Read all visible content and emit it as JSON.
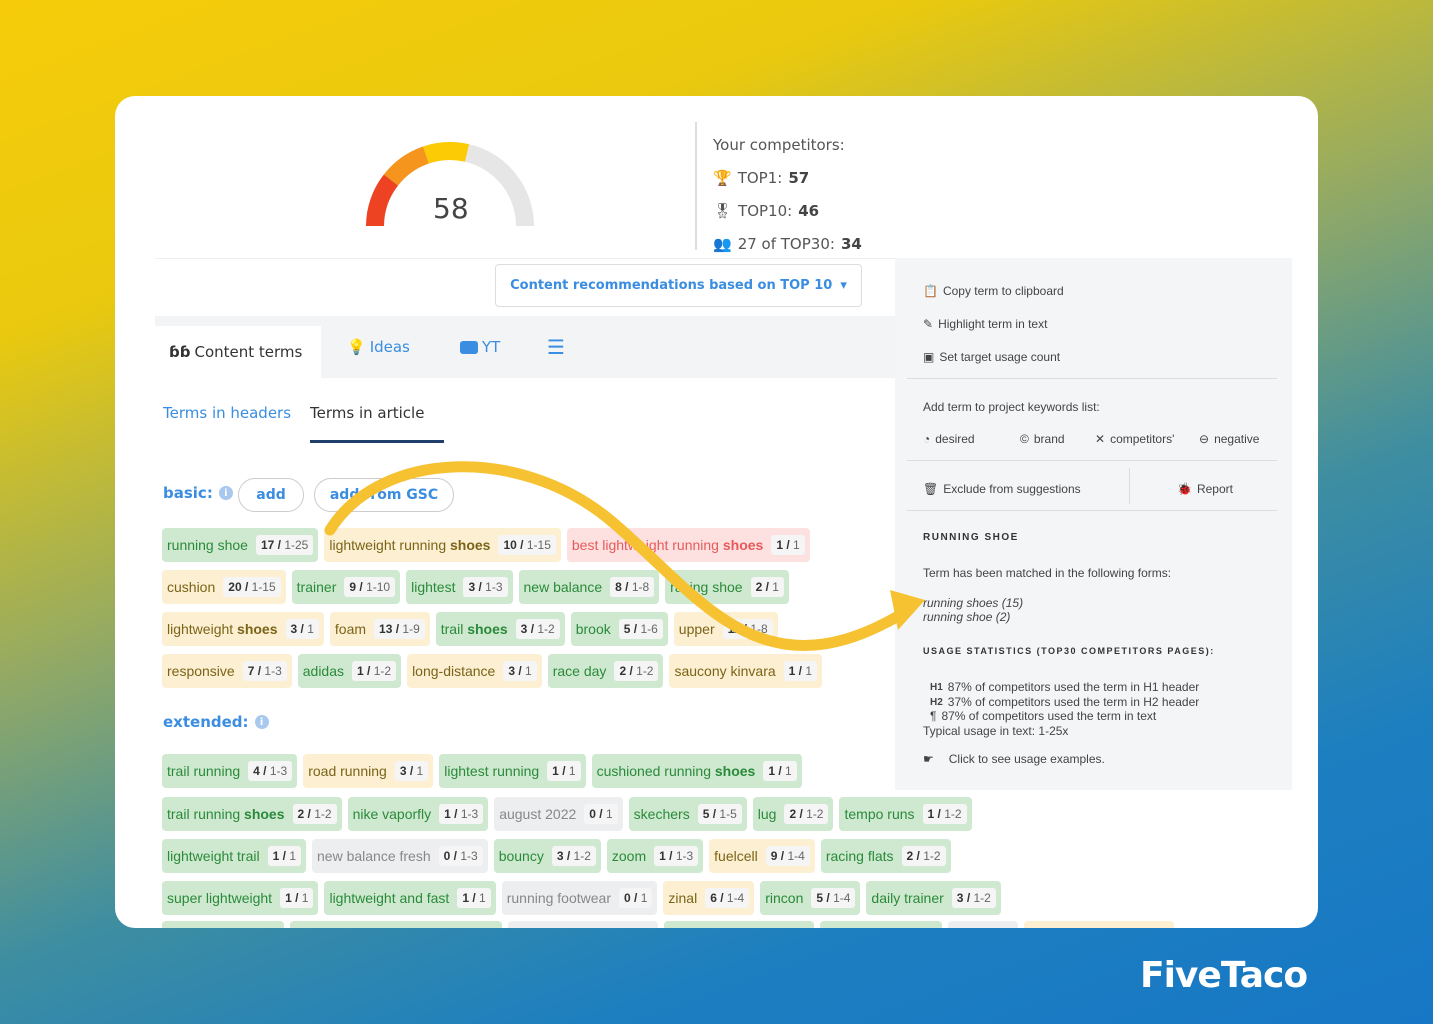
{
  "score": {
    "value": "58",
    "gauge_percent": 58,
    "colors": [
      "#ee4322",
      "#f5951e",
      "#fccb05",
      "#e6e6e6"
    ]
  },
  "competitors": {
    "title": "Your competitors:",
    "items": [
      {
        "icon": "trophy-icon",
        "label": "TOP1: ",
        "value": "57"
      },
      {
        "icon": "medal-icon",
        "label": "TOP10: ",
        "value": "46"
      },
      {
        "icon": "group-icon",
        "label": "27 of TOP30: ",
        "value": "34"
      }
    ]
  },
  "recommendations": {
    "label": "Content recommendations based on TOP 10"
  },
  "tabs": [
    {
      "label": "Content terms",
      "icon": "quote-icon"
    },
    {
      "label": "Ideas",
      "icon": "lightbulb-icon"
    },
    {
      "label": "YT",
      "icon": "youtube-icon"
    },
    {
      "label": "",
      "icon": "sliders-icon"
    }
  ],
  "subtabs": [
    "Terms in headers",
    "Terms in article"
  ],
  "basic": {
    "label": "basic:",
    "add": "add",
    "add_gsc": "add from GSC",
    "rows": [
      [
        {
          "t": "running shoe",
          "c": "17",
          "r": "1-25",
          "k": "g"
        },
        {
          "t": "lightweight running ",
          "b": "shoes",
          "c": "10",
          "r": "1-15",
          "k": "y"
        },
        {
          "t": "best lightweight running ",
          "b": "shoes",
          "c": "1",
          "r": "1",
          "k": "r"
        }
      ],
      [
        {
          "t": "cushion",
          "c": "20",
          "r": "1-15",
          "k": "y"
        },
        {
          "t": "trainer",
          "c": "9",
          "r": "1-10",
          "k": "g"
        },
        {
          "t": "lightest",
          "c": "3",
          "r": "1-3",
          "k": "g"
        },
        {
          "t": "new balance",
          "c": "8",
          "r": "1-8",
          "k": "g"
        },
        {
          "t": "racing shoe",
          "c": "2",
          "r": "1",
          "k": "g"
        }
      ],
      [
        {
          "t": "lightweight ",
          "b": "shoes",
          "c": "3",
          "r": "1",
          "k": "y"
        },
        {
          "t": "foam",
          "c": "13",
          "r": "1-9",
          "k": "y"
        },
        {
          "t": "trail ",
          "b": "shoes",
          "c": "3",
          "r": "1-2",
          "k": "g"
        },
        {
          "t": "brook",
          "c": "5",
          "r": "1-6",
          "k": "g"
        },
        {
          "t": "upper",
          "c": "11",
          "r": "1-8",
          "k": "y"
        }
      ],
      [
        {
          "t": "responsive",
          "c": "7",
          "r": "1-3",
          "k": "y"
        },
        {
          "t": "adidas",
          "c": "1",
          "r": "1-2",
          "k": "g"
        },
        {
          "t": "long-distance",
          "c": "3",
          "r": "1",
          "k": "y"
        },
        {
          "t": "race day",
          "c": "2",
          "r": "1-2",
          "k": "g"
        },
        {
          "t": "saucony kinvara",
          "c": "1",
          "r": "1",
          "k": "y"
        }
      ]
    ]
  },
  "extended": {
    "label": "extended:",
    "rows": [
      [
        {
          "t": "trail running",
          "c": "4",
          "r": "1-3",
          "k": "g"
        },
        {
          "t": "road running",
          "c": "3",
          "r": "1",
          "k": "y"
        },
        {
          "t": "lightest running",
          "c": "1",
          "r": "1",
          "k": "g"
        },
        {
          "t": "cushioned running ",
          "b": "shoes",
          "c": "1",
          "r": "1",
          "k": "g"
        }
      ],
      [
        {
          "t": "trail running ",
          "b": "shoes",
          "c": "2",
          "r": "1-2",
          "k": "g"
        },
        {
          "t": "nike vaporfly",
          "c": "1",
          "r": "1-3",
          "k": "g"
        },
        {
          "t": "august 2022",
          "c": "0",
          "r": "1",
          "k": "n"
        },
        {
          "t": "skechers",
          "c": "5",
          "r": "1-5",
          "k": "g"
        },
        {
          "t": "lug",
          "c": "2",
          "r": "1-2",
          "k": "g"
        },
        {
          "t": "tempo runs",
          "c": "1",
          "r": "1-2",
          "k": "g"
        }
      ],
      [
        {
          "t": "lightweight trail",
          "c": "1",
          "r": "1",
          "k": "g"
        },
        {
          "t": "new balance fresh",
          "c": "0",
          "r": "1-3",
          "k": "n"
        },
        {
          "t": "bouncy",
          "c": "3",
          "r": "1-2",
          "k": "g"
        },
        {
          "t": "zoom",
          "c": "1",
          "r": "1-3",
          "k": "g"
        },
        {
          "t": "fuelcell",
          "c": "9",
          "r": "1-4",
          "k": "y"
        },
        {
          "t": "racing flats",
          "c": "2",
          "r": "1-2",
          "k": "g"
        }
      ],
      [
        {
          "t": "super lightweight",
          "c": "1",
          "r": "1",
          "k": "g"
        },
        {
          "t": "lightweight and fast",
          "c": "1",
          "r": "1",
          "k": "g"
        },
        {
          "t": "running footwear",
          "c": "0",
          "r": "1",
          "k": "n"
        },
        {
          "t": "zinal",
          "c": "6",
          "r": "1-4",
          "k": "y"
        },
        {
          "t": "rincon",
          "c": "5",
          "r": "1-4",
          "k": "g"
        },
        {
          "t": "daily trainer",
          "c": "3",
          "r": "1-2",
          "k": "g"
        }
      ]
    ]
  },
  "panel": {
    "copy": "Copy term to clipboard",
    "highlight": "Highlight term in text",
    "target": "Set target usage count",
    "add_title": "Add term to project keywords list:",
    "desired": "desired",
    "brand": "brand",
    "competitors": "competitors'",
    "negative": "negative",
    "exclude": "Exclude from suggestions",
    "report": "Report",
    "term": "RUNNING SHOE",
    "matched": "Term has been matched in the following forms:",
    "form1": "running shoes (15)",
    "form2": "running shoe (2)",
    "usage_title": "USAGE STATISTICS (TOP30 COMPETITORS PAGES):",
    "h1": "H1",
    "h1_text": "87% of competitors used the term in H1 header",
    "h2": "H2",
    "h2_text": "37% of competitors used the term in H2 header",
    "text_stat": "87% of competitors used the term in text",
    "typical": "Typical usage in text: 1-25x",
    "examples": "Click to see usage examples."
  },
  "brand": {
    "logo": "FiveTaco"
  }
}
